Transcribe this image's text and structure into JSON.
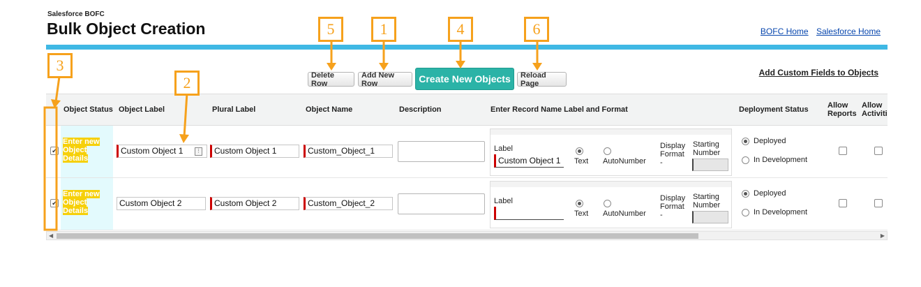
{
  "header": {
    "app_name": "Salesforce BOFC",
    "title": "Bulk Object Creation",
    "links": [
      "BOFC Home",
      "Salesforce Home"
    ]
  },
  "toolbar": {
    "delete_row": "Delete Row",
    "add_new_row": "Add New Row",
    "create_new_objects": "Create New Objects",
    "reload_page": "Reload Page",
    "add_custom_fields": "Add Custom Fields to Objects"
  },
  "table": {
    "columns": {
      "object_status": "Object Status",
      "object_label": "Object Label",
      "plural_label": "Plural Label",
      "object_name": "Object Name",
      "description": "Description",
      "record_name": "Enter Record Name Label and Format",
      "deployment_status": "Deployment Status",
      "allow_reports_1": "Allow",
      "allow_reports_2": "Reports",
      "allow_activities_1": "Allow",
      "allow_activities_2": "Activiti"
    },
    "rows": [
      {
        "selected": true,
        "status": "Enter new Object Details",
        "object_label": "Custom Object 1",
        "plural_label": "Custom Object 1",
        "object_name": "Custom_Object_1",
        "record_label_caption": "Label",
        "record_label_value": "Custom Object 1",
        "format_text": "Text",
        "format_auto": "AutoNumber",
        "format_selected": "Text",
        "display_format_1": "Display",
        "display_format_2": "Format",
        "display_format_3": "-",
        "starting_number_1": "Starting",
        "starting_number_2": "Number",
        "deployed": "Deployed",
        "in_development": "In Development",
        "deployment_selected": "Deployed"
      },
      {
        "selected": true,
        "status": "Enter new Object Details",
        "object_label": "Custom Object 2",
        "plural_label": "Custom Object 2",
        "object_name": "Custom_Object_2",
        "record_label_caption": "Label",
        "record_label_value": "",
        "format_text": "Text",
        "format_auto": "AutoNumber",
        "format_selected": "Text",
        "display_format_1": "Display",
        "display_format_2": "Format",
        "display_format_3": "-",
        "starting_number_1": "Starting",
        "starting_number_2": "Number",
        "deployed": "Deployed",
        "in_development": "In Development",
        "deployment_selected": "Deployed"
      }
    ]
  },
  "callouts": [
    "1",
    "2",
    "3",
    "4",
    "5",
    "6"
  ],
  "colors": {
    "accent_bar": "#3fb8e4",
    "primary_button": "#2bb3a7",
    "callout": "#f6a11c",
    "status_highlight": "#f6d00a",
    "required_marker": "#c00000"
  }
}
